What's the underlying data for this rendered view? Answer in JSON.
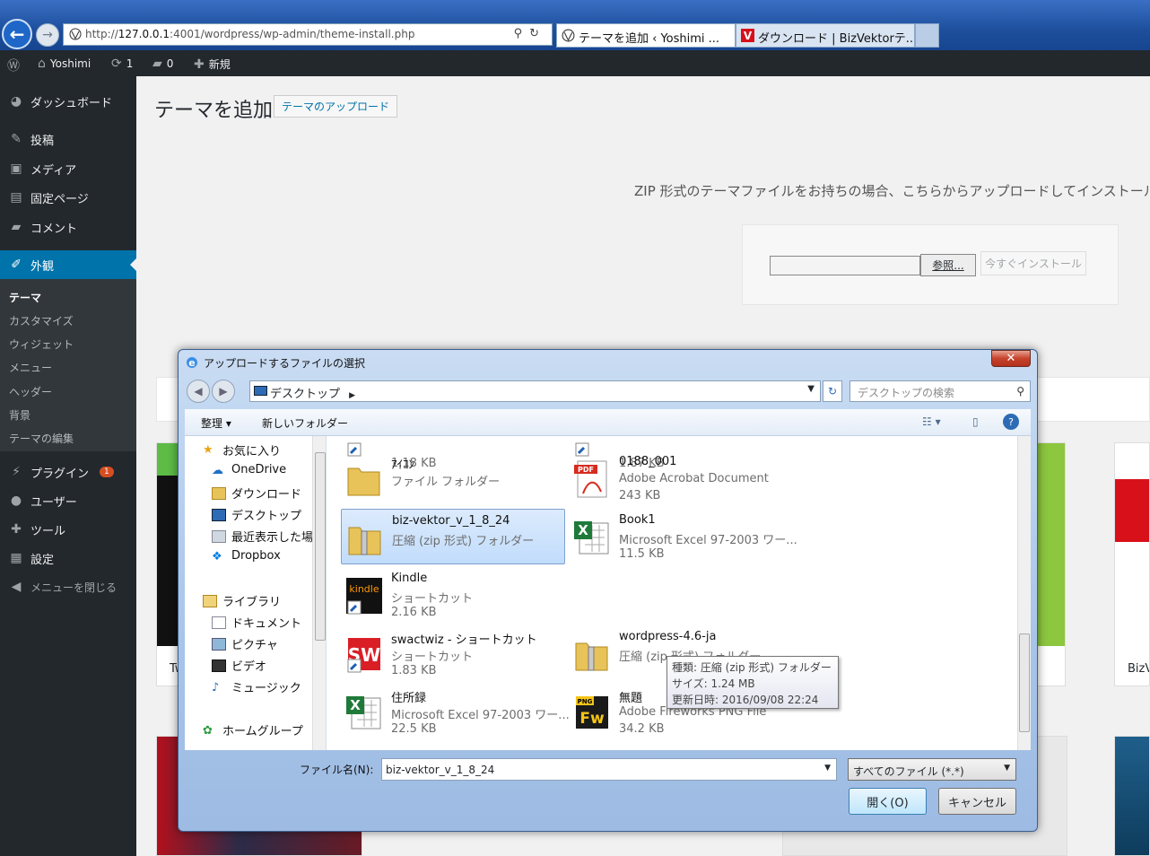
{
  "browser": {
    "address_prefix": "http://",
    "address_host": "127.0.0.1",
    "address_rest": ":4001/wordpress/wp-admin/theme-install.php",
    "tabs": [
      {
        "label": "テーマを追加 ‹ Yoshimi ..."
      },
      {
        "label": "ダウンロード | BizVektorテ..."
      }
    ]
  },
  "adminbar": {
    "site_name": "Yoshimi",
    "updates": "1",
    "comments": "0",
    "new_label": "新規"
  },
  "sidebar": {
    "items": [
      {
        "label": "ダッシュボード",
        "icon": "dashboard-icon"
      },
      {
        "label": "投稿",
        "icon": "pin-icon"
      },
      {
        "label": "メディア",
        "icon": "media-icon"
      },
      {
        "label": "固定ページ",
        "icon": "page-icon"
      },
      {
        "label": "コメント",
        "icon": "comment-icon"
      },
      {
        "label": "外観",
        "icon": "brush-icon"
      },
      {
        "label": "プラグイン",
        "icon": "plugin-icon",
        "badge": "1"
      },
      {
        "label": "ユーザー",
        "icon": "user-icon"
      },
      {
        "label": "ツール",
        "icon": "wrench-icon"
      },
      {
        "label": "設定",
        "icon": "settings-icon"
      },
      {
        "label": "メニューを閉じる",
        "icon": "collapse-icon"
      }
    ],
    "submenu": [
      "テーマ",
      "カスタマイズ",
      "ウィジェット",
      "メニュー",
      "ヘッダー",
      "背景",
      "テーマの編集"
    ]
  },
  "main": {
    "title": "テーマを追加",
    "upload_button": "テーマのアップロード",
    "upload_desc": "ZIP 形式のテーマファイルをお持ちの場合、こちらからアップロードしてインストール",
    "browse_label": "参照...",
    "install_label": "今すぐインストール",
    "theme_names": [
      "Tw",
      "BizV"
    ]
  },
  "dialog": {
    "title": "アップロードするファイルの選択",
    "path": "デスクトップ",
    "search_placeholder": "デスクトップの検索",
    "organize": "整理 ▾",
    "new_folder": "新しいフォルダー",
    "nav": [
      {
        "label": "お気に入り",
        "icon": "star-icon"
      },
      {
        "label": "OneDrive",
        "icon": "cloud-icon"
      },
      {
        "label": "ダウンロード",
        "icon": "download-folder-icon"
      },
      {
        "label": "デスクトップ",
        "icon": "desktop-icon"
      },
      {
        "label": "最近表示した場所",
        "icon": "recent-icon"
      },
      {
        "label": "Dropbox",
        "icon": "dropbox-icon"
      },
      {
        "label": "ライブラリ",
        "icon": "library-icon"
      },
      {
        "label": "ドキュメント",
        "icon": "document-icon"
      },
      {
        "label": "ピクチャ",
        "icon": "picture-icon"
      },
      {
        "label": "ビデオ",
        "icon": "video-icon"
      },
      {
        "label": "ミュージック",
        "icon": "music-icon"
      },
      {
        "label": "ホームグループ",
        "icon": "homegroup-icon"
      }
    ],
    "files": [
      {
        "name": "",
        "type": "",
        "size": "1.18 KB"
      },
      {
        "name": "",
        "type": "",
        "size": "1.87 KB"
      },
      {
        "name": "ｱｲｺﾝ",
        "type": "ファイル フォルダー",
        "size": ""
      },
      {
        "name": "0188_001",
        "type": "Adobe Acrobat Document",
        "size": "243 KB"
      },
      {
        "name": "biz-vektor_v_1_8_24",
        "type": "圧縮 (zip 形式) フォルダー",
        "size": ""
      },
      {
        "name": "Book1",
        "type": "Microsoft Excel 97-2003 ワー...",
        "size": "11.5 KB"
      },
      {
        "name": "Kindle",
        "type": "ショートカット",
        "size": "2.16 KB"
      },
      {
        "name": "swactwiz - ショートカット",
        "type": "ショートカット",
        "size": "1.83 KB"
      },
      {
        "name": "wordpress-4.6-ja",
        "type": "圧縮 (zip 形式) フォルダー",
        "size": ""
      },
      {
        "name": "住所録",
        "type": "Microsoft Excel 97-2003 ワー...",
        "size": "22.5 KB"
      },
      {
        "name": "無題",
        "type": "Adobe Fireworks PNG File",
        "size": "34.2 KB"
      }
    ],
    "tooltip": {
      "type": "種類: 圧縮 (zip 形式) フォルダー",
      "size": "サイズ: 1.24 MB",
      "date": "更新日時: 2016/09/08 22:24"
    },
    "filename_label": "ファイル名(N):",
    "filename_value": "biz-vektor_v_1_8_24",
    "filter": "すべてのファイル (*.*)",
    "open": "開く(O)",
    "cancel": "キャンセル"
  }
}
